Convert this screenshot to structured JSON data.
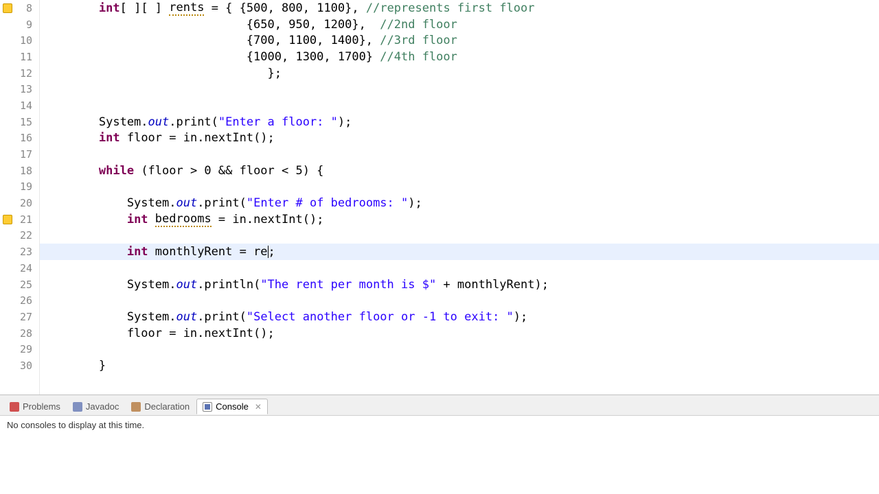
{
  "lines": [
    {
      "n": 8,
      "ico": "bulb"
    },
    {
      "n": 9
    },
    {
      "n": 10
    },
    {
      "n": 11
    },
    {
      "n": 12
    },
    {
      "n": 13
    },
    {
      "n": 14
    },
    {
      "n": 15
    },
    {
      "n": 16
    },
    {
      "n": 17
    },
    {
      "n": 18
    },
    {
      "n": 19
    },
    {
      "n": 20
    },
    {
      "n": 21,
      "ico": "bulb"
    },
    {
      "n": 22
    },
    {
      "n": 23,
      "hl": true
    },
    {
      "n": 24
    },
    {
      "n": 25
    },
    {
      "n": 26
    },
    {
      "n": 27
    },
    {
      "n": 28
    },
    {
      "n": 29
    },
    {
      "n": 30
    }
  ],
  "code": {
    "8": [
      [
        "        ",
        "norm"
      ],
      [
        "int",
        "kw"
      ],
      [
        "[ ][ ] ",
        "norm"
      ],
      [
        "rents",
        "warn"
      ],
      [
        " = { {500, 800, 1100}, ",
        "norm"
      ],
      [
        "//represents first floor",
        "com"
      ]
    ],
    "9": [
      [
        "                             {650, 950, 1200},  ",
        "norm"
      ],
      [
        "//2nd floor",
        "com"
      ]
    ],
    "10": [
      [
        "                             {700, 1100, 1400}, ",
        "norm"
      ],
      [
        "//3rd floor",
        "com"
      ]
    ],
    "11": [
      [
        "                             {1000, 1300, 1700} ",
        "norm"
      ],
      [
        "//4th floor",
        "com"
      ]
    ],
    "12": [
      [
        "                                };",
        "norm"
      ]
    ],
    "13": [
      [
        "",
        "norm"
      ]
    ],
    "14": [
      [
        "",
        "norm"
      ]
    ],
    "15": [
      [
        "        System.",
        "norm"
      ],
      [
        "out",
        "fld"
      ],
      [
        ".print(",
        "norm"
      ],
      [
        "\"Enter a floor: \"",
        "str"
      ],
      [
        ");",
        "norm"
      ]
    ],
    "16": [
      [
        "        ",
        "norm"
      ],
      [
        "int",
        "kw"
      ],
      [
        " floor = in.nextInt();",
        "norm"
      ]
    ],
    "17": [
      [
        "",
        "norm"
      ]
    ],
    "18": [
      [
        "        ",
        "norm"
      ],
      [
        "while",
        "kw"
      ],
      [
        " (floor > 0 && floor < 5) {",
        "norm"
      ]
    ],
    "19": [
      [
        "",
        "norm"
      ]
    ],
    "20": [
      [
        "            System.",
        "norm"
      ],
      [
        "out",
        "fld"
      ],
      [
        ".print(",
        "norm"
      ],
      [
        "\"Enter # of bedrooms: \"",
        "str"
      ],
      [
        ");",
        "norm"
      ]
    ],
    "21": [
      [
        "            ",
        "norm"
      ],
      [
        "int",
        "kw"
      ],
      [
        " ",
        "norm"
      ],
      [
        "bedrooms",
        "warn"
      ],
      [
        " = in.nextInt();",
        "norm"
      ]
    ],
    "22": [
      [
        "",
        "norm"
      ]
    ],
    "23": [
      [
        "            ",
        "norm"
      ],
      [
        "int",
        "kw"
      ],
      [
        " monthlyRent = re",
        "norm"
      ],
      [
        "|",
        "cursor"
      ],
      [
        ";",
        "norm"
      ]
    ],
    "24": [
      [
        "",
        "norm"
      ]
    ],
    "25": [
      [
        "            System.",
        "norm"
      ],
      [
        "out",
        "fld"
      ],
      [
        ".println(",
        "norm"
      ],
      [
        "\"The rent per month is $\"",
        "str"
      ],
      [
        " + monthlyRent);",
        "norm"
      ]
    ],
    "26": [
      [
        "",
        "norm"
      ]
    ],
    "27": [
      [
        "            System.",
        "norm"
      ],
      [
        "out",
        "fld"
      ],
      [
        ".print(",
        "norm"
      ],
      [
        "\"Select another floor or -1 to exit: \"",
        "str"
      ],
      [
        ");",
        "norm"
      ]
    ],
    "28": [
      [
        "            floor = in.nextInt();",
        "norm"
      ]
    ],
    "29": [
      [
        "",
        "norm"
      ]
    ],
    "30": [
      [
        "        }",
        "norm"
      ]
    ]
  },
  "tabs": {
    "problems": "Problems",
    "javadoc": "Javadoc",
    "declaration": "Declaration",
    "console": "Console"
  },
  "console": {
    "empty_msg": "No consoles to display at this time."
  }
}
